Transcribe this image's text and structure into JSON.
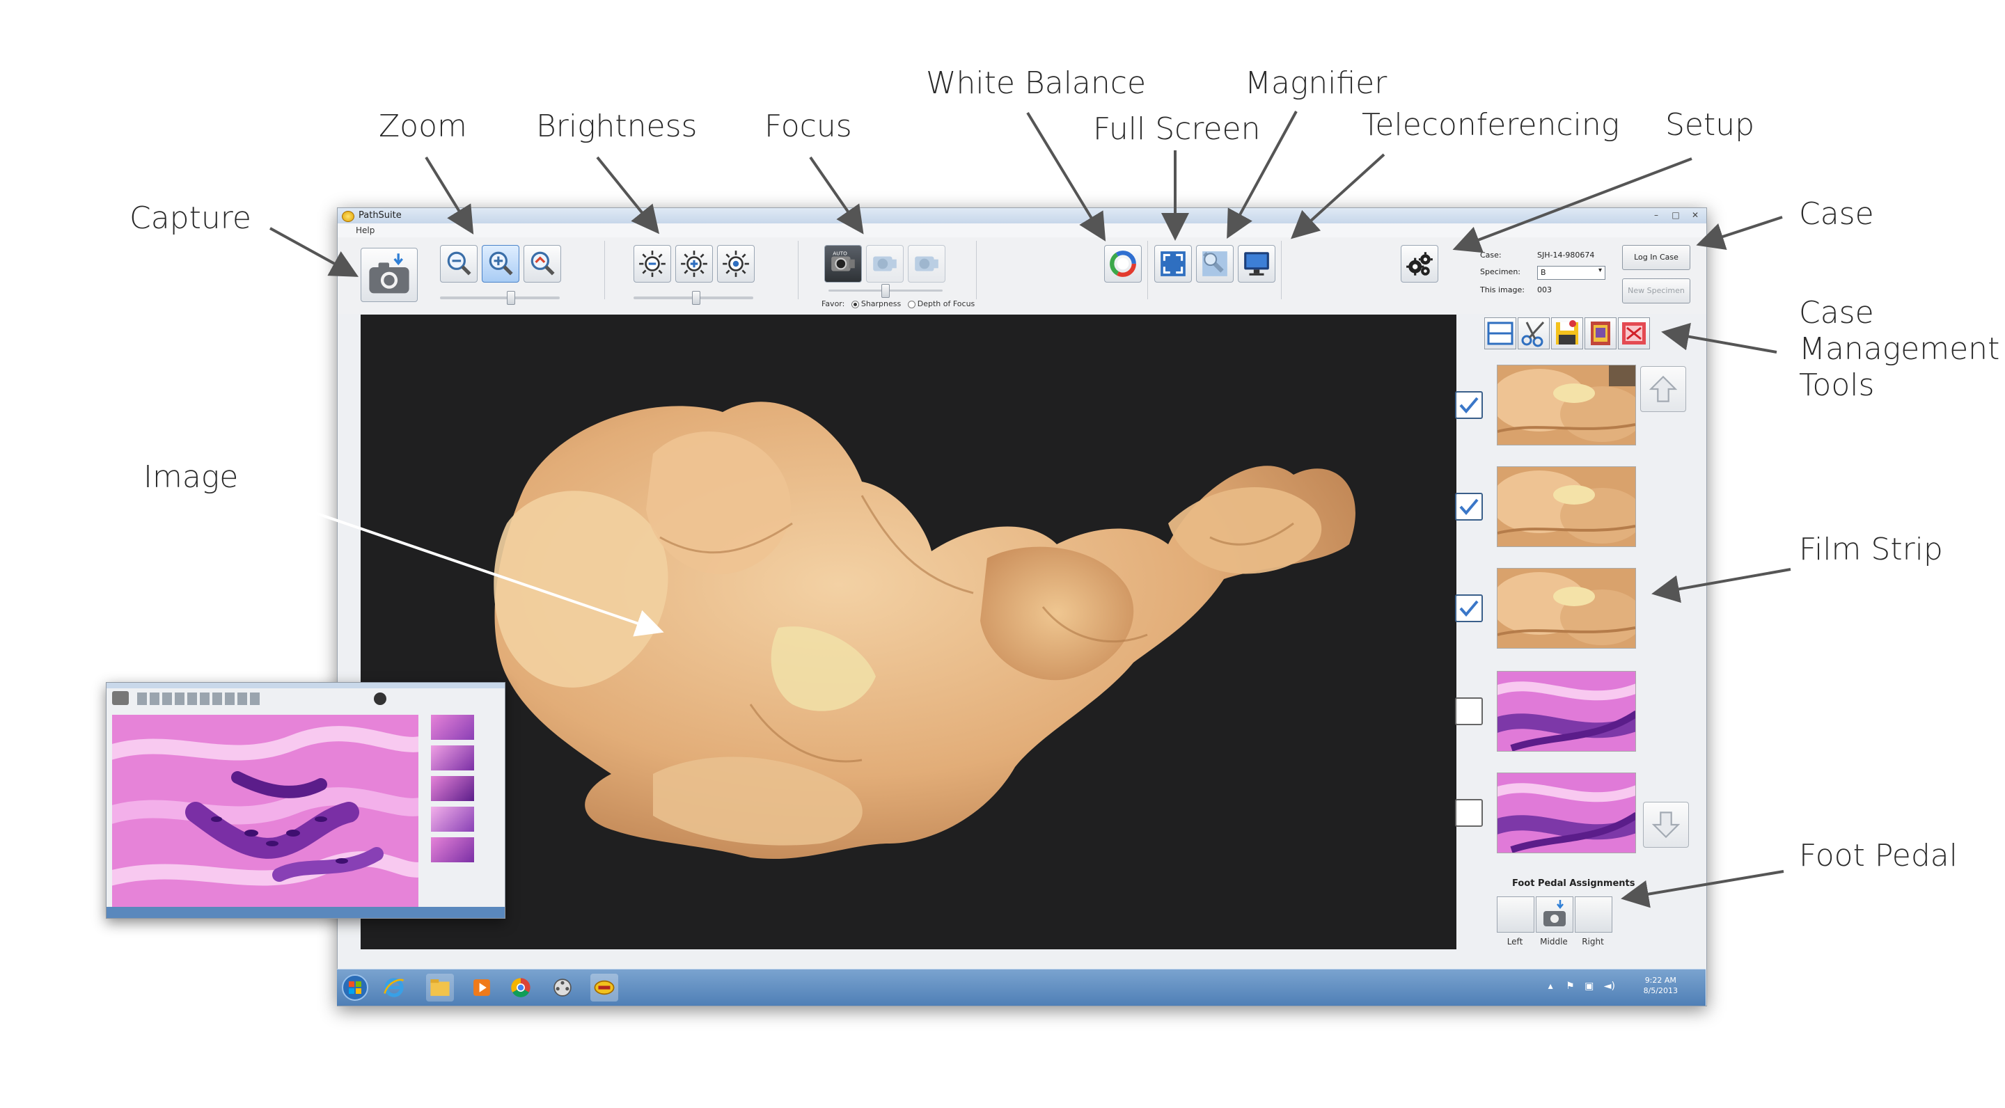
{
  "callouts": {
    "capture": "Capture",
    "zoom": "Zoom",
    "brightness": "Brightness",
    "focus": "Focus",
    "white_balance": "White Balance",
    "full_screen": "Full Screen",
    "magnifier": "Magnifier",
    "teleconferencing": "Teleconferencing",
    "setup": "Setup",
    "case": "Case",
    "case_management_tools": "Case Management Tools",
    "image": "Image",
    "film_strip": "Film Strip",
    "foot_pedal": "Foot Pedal"
  },
  "window": {
    "title": "PathSuite",
    "menu_help": "Help",
    "controls": [
      "–",
      "□",
      "✕"
    ]
  },
  "toolbar": {
    "favor_label": "Favor:",
    "favor_options": [
      "Sharpness",
      "Depth of Focus"
    ],
    "favor_selected": "Sharpness",
    "icons": [
      "capture-camera-icon",
      "zoom-out-icon",
      "zoom-in-icon",
      "zoom-fit-icon",
      "brightness-down-icon",
      "brightness-up-icon",
      "brightness-auto-icon",
      "focus-auto-icon",
      "focus-near-icon",
      "focus-far-icon",
      "white-balance-icon",
      "full-screen-icon",
      "magnifier-icon",
      "teleconference-monitor-icon",
      "setup-gears-icon"
    ]
  },
  "case_panel": {
    "case_label": "Case:",
    "case_value": "SJH-14-980674",
    "specimen_label": "Specimen:",
    "specimen_value": "B",
    "this_image_label": "This image:",
    "this_image_value": "003",
    "log_in_button": "Log In Case",
    "new_specimen_button": "New Specimen"
  },
  "film_strip": {
    "items": [
      {
        "checked": true,
        "kind": "gross"
      },
      {
        "checked": true,
        "kind": "gross"
      },
      {
        "checked": true,
        "kind": "gross"
      },
      {
        "checked": false,
        "kind": "histology"
      },
      {
        "checked": false,
        "kind": "histology"
      }
    ]
  },
  "foot_pedal": {
    "title": "Foot Pedal Assignments",
    "left": "Left",
    "middle": "Middle",
    "right": "Right"
  },
  "taskbar": {
    "time": "9:22 AM",
    "date": "8/5/2013"
  },
  "colors": {
    "accent_blue": "#3a77c8",
    "taskbar": "#5a88bd",
    "tissue": "#e5b27e",
    "histology_pink": "#e07ad8",
    "histology_purple": "#7d38a8"
  }
}
